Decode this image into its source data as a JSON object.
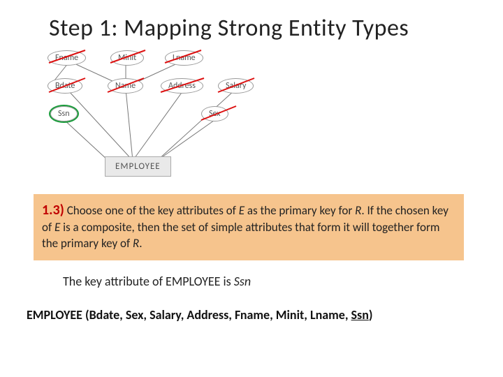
{
  "title": "Step 1: Mapping Strong Entity Types",
  "diagram": {
    "entity": "EMPLOYEE",
    "attributes": {
      "fname": {
        "label": "Fname",
        "crossed": true,
        "key": false
      },
      "minit": {
        "label": "Minit",
        "crossed": true,
        "key": false
      },
      "lname": {
        "label": "Lname",
        "crossed": true,
        "key": false
      },
      "bdate": {
        "label": "Bdate",
        "crossed": true,
        "key": false
      },
      "name": {
        "label": "Name",
        "crossed": true,
        "key": false
      },
      "address": {
        "label": "Address",
        "crossed": true,
        "key": false
      },
      "salary": {
        "label": "Salary",
        "crossed": true,
        "key": false
      },
      "ssn": {
        "label": "Ssn",
        "crossed": false,
        "key": true
      },
      "sex": {
        "label": "Sex",
        "crossed": true,
        "key": false
      }
    }
  },
  "rule": {
    "number": "1.3)",
    "partA": " Choose one of the key attributes of ",
    "E1": "E",
    "partB": " as the primary key for ",
    "R1": "R",
    "partC": ". If the chosen key of ",
    "E2": "E",
    "partD": " is a composite, then the set of simple attributes    that form it will together form the primary key of ",
    "R2": "R",
    "partE": "."
  },
  "note": {
    "prefix": "The key attribute of EMPLOYEE is ",
    "attr": "Ssn"
  },
  "schema": {
    "prefix": "EMPLOYEE (Bdate, Sex, Salary, Address, Fname, Minit, Lname, ",
    "key": "Ssn",
    "suffix": ")"
  }
}
